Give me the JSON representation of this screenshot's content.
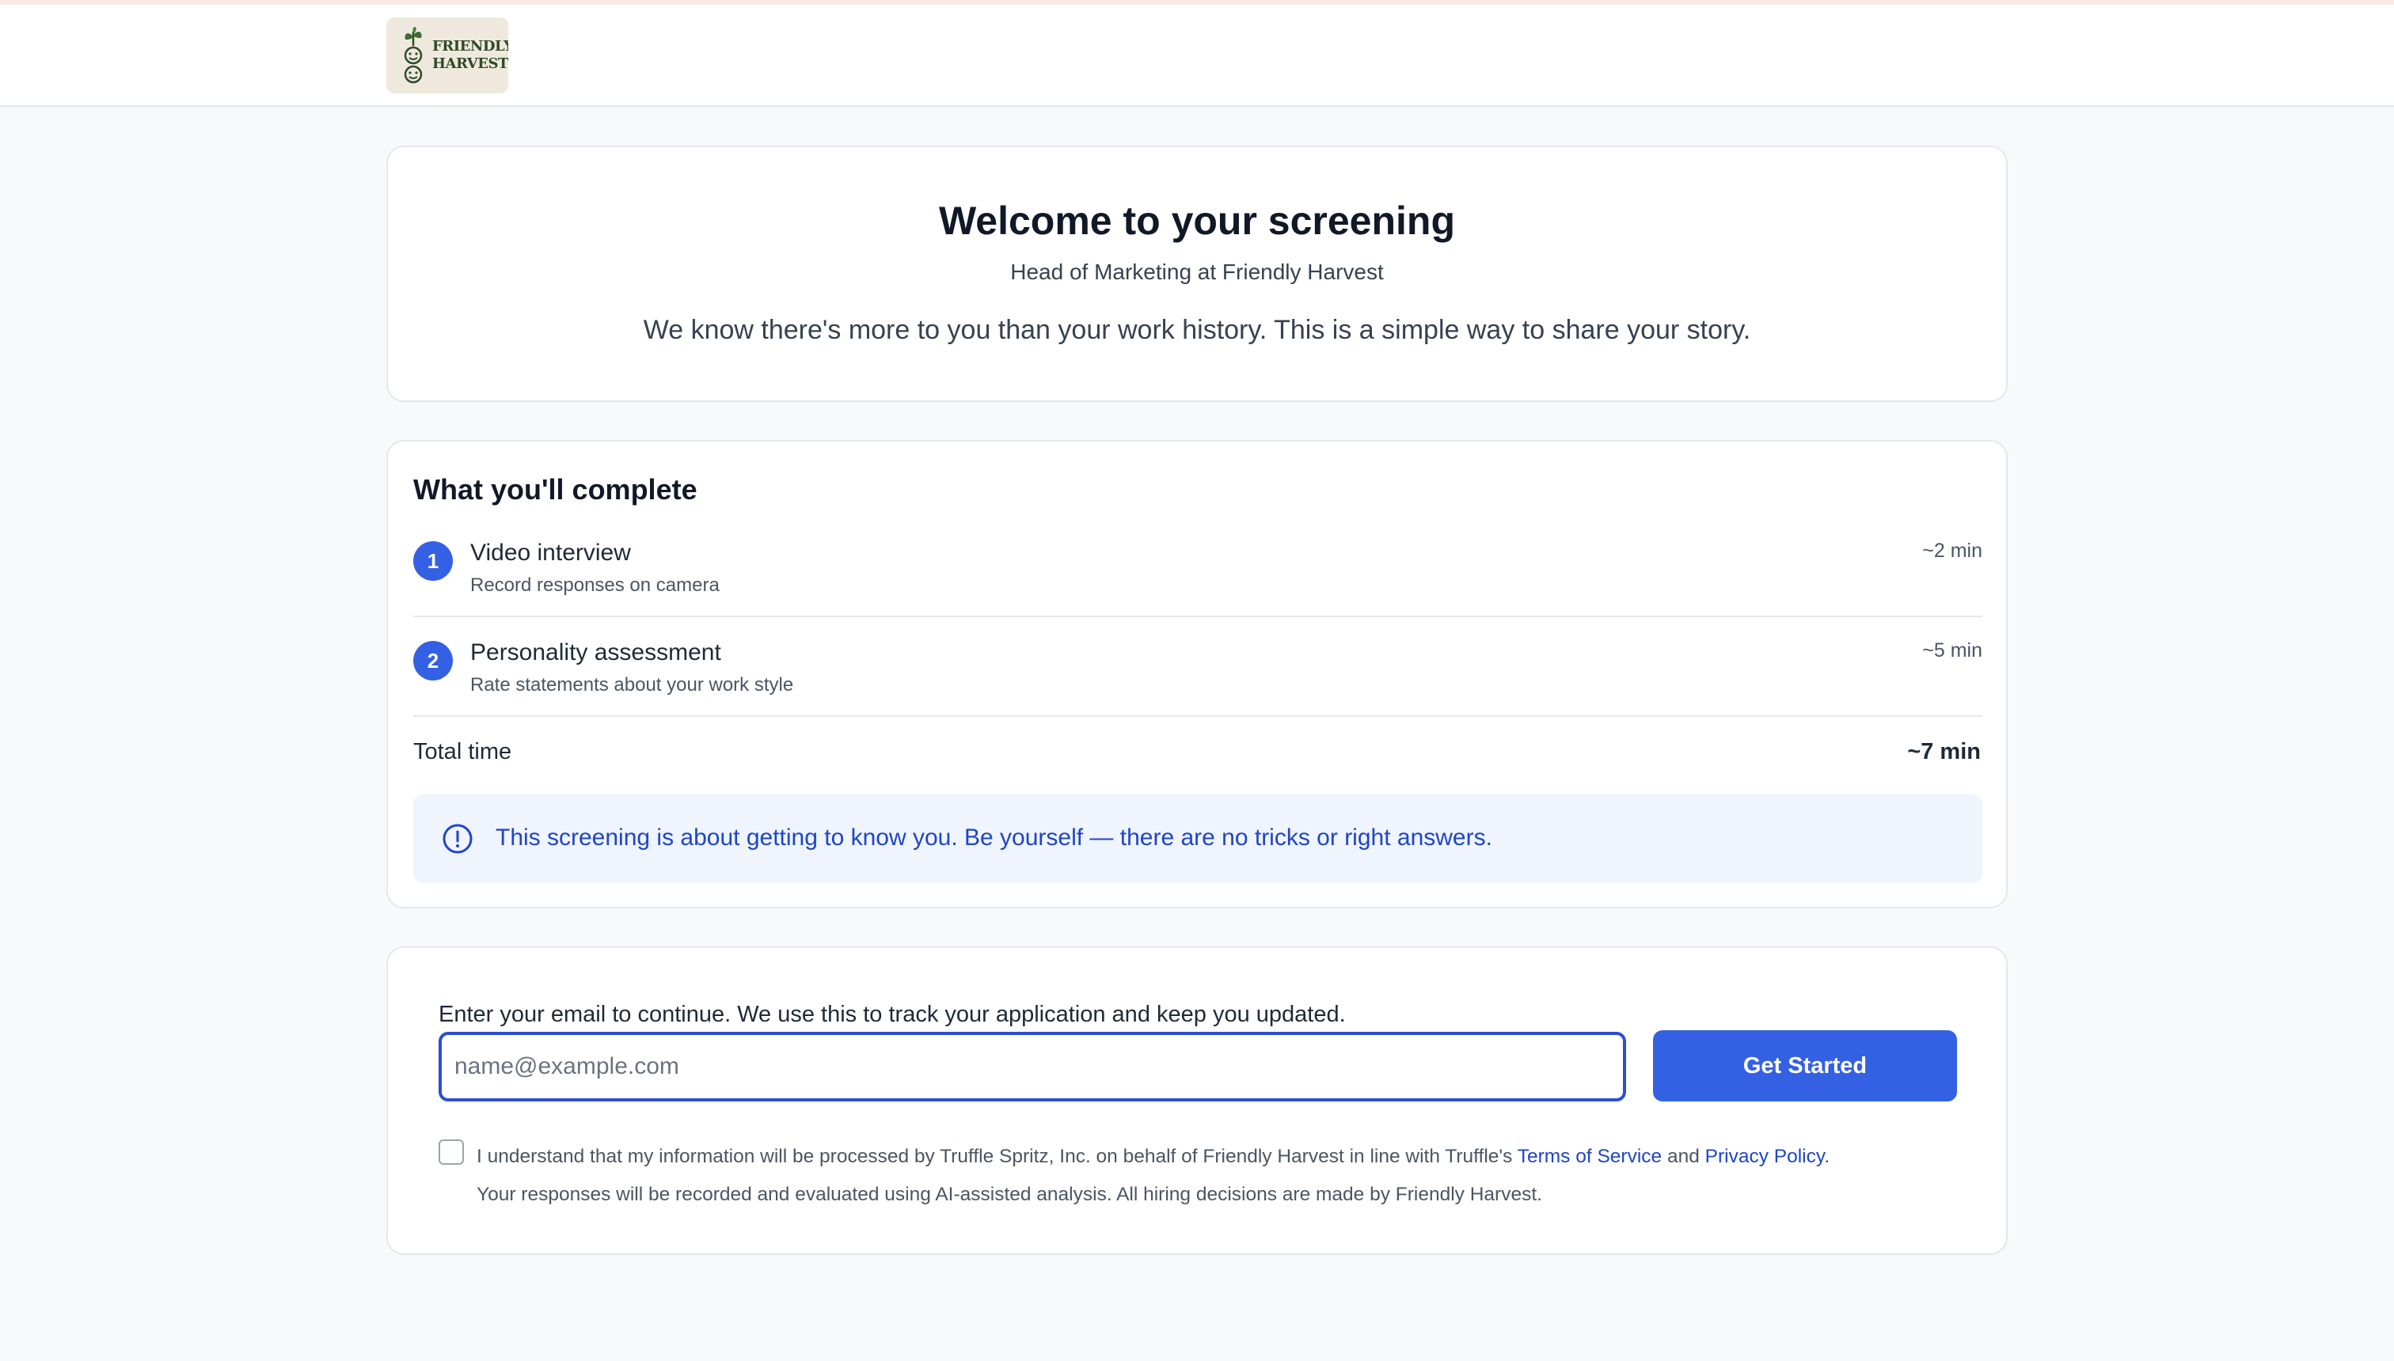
{
  "header": {
    "logo_text_line1": "FRIENDLY",
    "logo_text_line2": "HARVEST"
  },
  "welcome": {
    "title": "Welcome to your screening",
    "subtitle": "Head of Marketing at Friendly Harvest",
    "description": "We know there's more to you than your work history. This is a simple way to share your story."
  },
  "steps": {
    "title": "What you'll complete",
    "items": [
      {
        "number": "1",
        "name": "Video interview",
        "description": "Record responses on camera",
        "time": "~2 min"
      },
      {
        "number": "2",
        "name": "Personality assessment",
        "description": "Rate statements about your work style",
        "time": "~5 min"
      }
    ],
    "total_label": "Total time",
    "total_value": "~7 min",
    "notice": "This screening is about getting to know you. Be yourself — there are no tricks or right answers.",
    "notice_icon": "info-circle-icon"
  },
  "email": {
    "label": "Enter your email to continue. We use this to track your application and keep you updated.",
    "placeholder": "name@example.com",
    "value": "",
    "button_label": "Get Started",
    "consent_prefix": "I understand that my information will be processed by Truffle Spritz, Inc. on behalf of Friendly Harvest in line with Truffle's ",
    "terms_link": "Terms of Service",
    "consent_and": " and ",
    "privacy_link": "Privacy Policy",
    "consent_period": ".",
    "consent_line2": "Your responses will be recorded and evaluated using AI-assisted analysis. All hiring decisions are made by Friendly Harvest."
  },
  "colors": {
    "accent": "#3461e3",
    "link": "#1e45c8",
    "notice_bg": "#eff4fd",
    "page_bg": "#f8f9fb"
  }
}
